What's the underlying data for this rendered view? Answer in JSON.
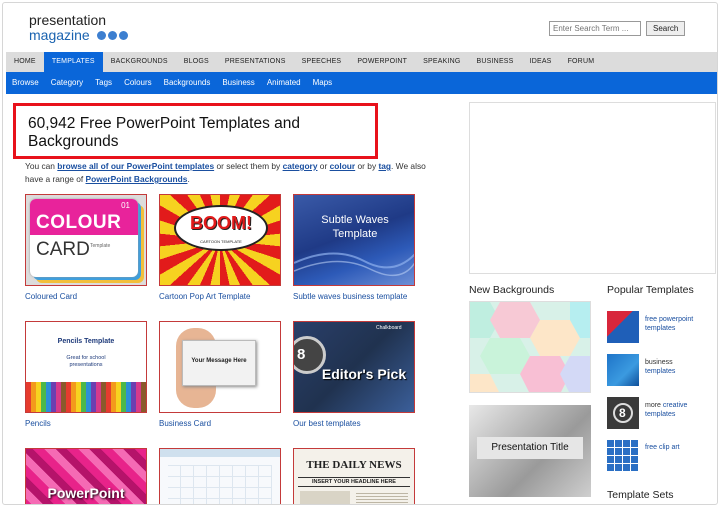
{
  "logo": {
    "line1": "presentation",
    "line2": "magazine"
  },
  "search": {
    "placeholder": "Enter Search Term ...",
    "button_label": "Search"
  },
  "nav_main": [
    "HOME",
    "TEMPLATES",
    "BACKGROUNDS",
    "BLOGS",
    "PRESENTATIONS",
    "SPEECHES",
    "POWERPOINT",
    "SPEAKING",
    "BUSINESS",
    "IDEAS",
    "FORUM"
  ],
  "nav_main_active": "TEMPLATES",
  "nav_sub": [
    "Browse",
    "Category",
    "Tags",
    "Colours",
    "Backgrounds",
    "Business",
    "Animated",
    "Maps"
  ],
  "headline": "60,942 Free PowerPoint Templates and Backgrounds",
  "intro": {
    "t1": "You can ",
    "link_browse": "browse all of our PowerPoint templates",
    "t2": " or select them by ",
    "link_category": "category",
    "t3": " or ",
    "link_colour": "colour",
    "t4": " or by ",
    "link_tag": "tag",
    "t5": ". We also have a range of ",
    "link_backgrounds": "PowerPoint Backgrounds",
    "t6": "."
  },
  "tiles": {
    "coloured_card": {
      "caption": "Coloured Card",
      "thumb_line1": "COLOUR",
      "thumb_line2": "CARD",
      "thumb_num": "01",
      "thumb_side": "Template"
    },
    "cartoon_pop": {
      "caption": "Cartoon Pop Art Template",
      "thumb_boom": "BOOM!",
      "thumb_sub": "CARTOON TEMPLATE"
    },
    "subtle_waves": {
      "caption": "Subtle waves business template",
      "thumb_title": "Subtle Waves Template"
    },
    "pencils": {
      "caption": "Pencils",
      "thumb_title": "Pencils Template",
      "thumb_sub": "Great for school presentations"
    },
    "business_card": {
      "caption": "Business Card",
      "thumb_msg": "Your Message Here"
    },
    "best": {
      "caption": "Our best templates",
      "thumb_title": "Editor's Pick",
      "thumb_board": "Chalkboard"
    },
    "powerpoint": {
      "thumb_text": "PowerPoint"
    },
    "daily_news": {
      "thumb_title": "THE DAILY NEWS",
      "thumb_sub": "INSERT YOUR HEADLINE HERE"
    }
  },
  "right": {
    "new_backgrounds_title": "New Backgrounds",
    "presentation_title_label": "Presentation Title",
    "popular_title": "Popular Templates",
    "popular": [
      {
        "lead": "",
        "link": "free powerpoint templates"
      },
      {
        "lead": "business",
        "link": "templates"
      },
      {
        "lead": "more ",
        "link": "creative templates"
      },
      {
        "lead": "",
        "link": "free clip art"
      }
    ],
    "template_sets_title": "Template Sets",
    "popular_thumb_num": "8"
  },
  "colors": {
    "nav_blue": "#0a66d9",
    "headline_border": "#e8111b",
    "link": "#1a4fa0"
  }
}
